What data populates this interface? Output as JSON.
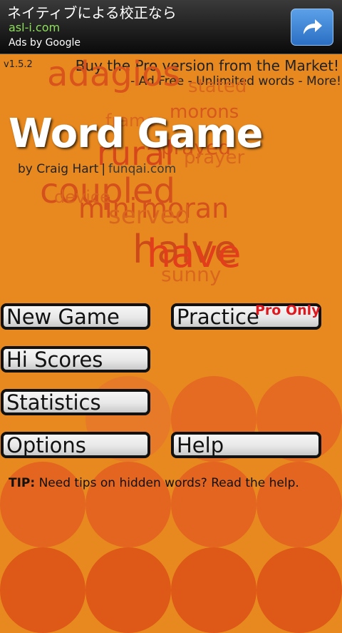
{
  "ad": {
    "title": "ネイティブによる校正なら",
    "url": "asl-i.com",
    "attribution": "Ads by Google",
    "button_icon": "share-arrow-icon"
  },
  "version": "v1.5.2",
  "promo": {
    "line1": "Buy the Pro version from the Market!",
    "line2": "- Ad Free  - Unlimited words  - More!"
  },
  "cloud_words": [
    "adagios",
    "stated",
    "morons",
    "frame",
    "prayer",
    "rural",
    "coupled",
    "device",
    "mini",
    "served",
    "halve",
    "have",
    "sunny",
    "prayed",
    "moran"
  ],
  "title": "Word Game",
  "byline": {
    "author": "by Craig Hart",
    "separator": "|",
    "site": "funqai.com"
  },
  "menu": {
    "new_game": "New Game",
    "practice": "Practice",
    "practice_badge": "Pro Only",
    "hi_scores": "Hi Scores",
    "statistics": "Statistics",
    "options": "Options",
    "help": "Help"
  },
  "tip": {
    "label": "TIP:",
    "text": "Need tips on hidden words? Read the help."
  },
  "colors": {
    "background": "#e8891f",
    "circle": "#e56a22",
    "circle_dark": "#de5818",
    "cloud_word": "#d95a1c",
    "badge": "#e0181e"
  }
}
